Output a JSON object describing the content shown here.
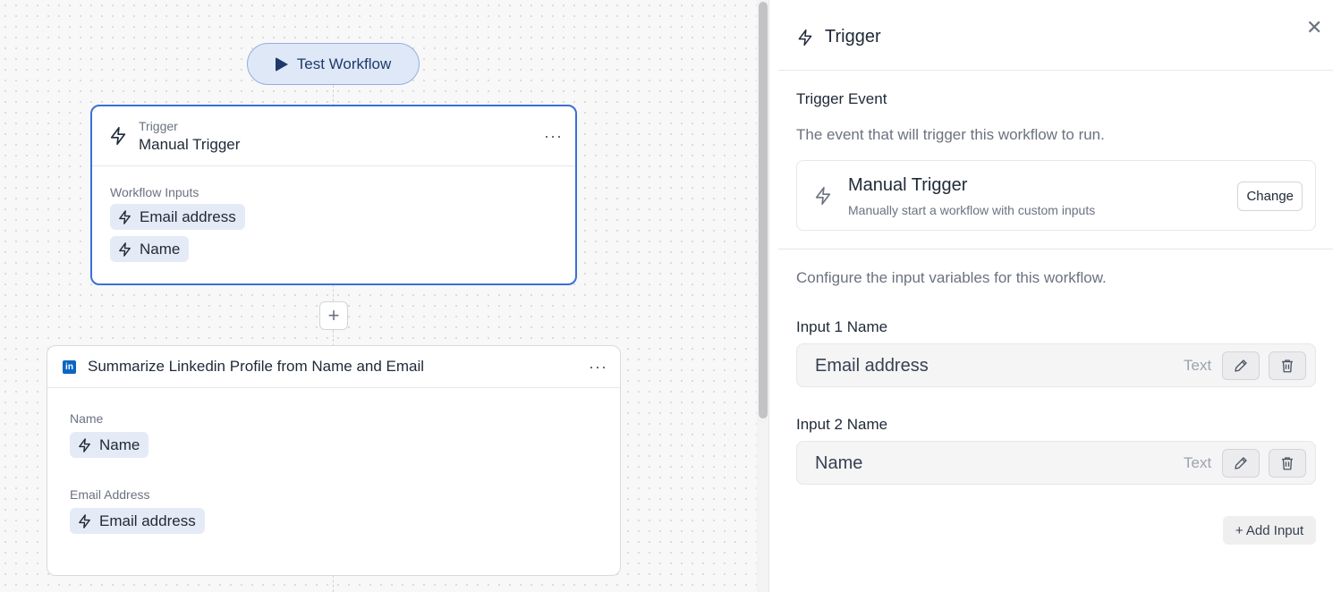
{
  "canvas": {
    "test_button_label": "Test Workflow",
    "trigger_node": {
      "type_label": "Trigger",
      "title": "Manual Trigger",
      "section_label": "Workflow Inputs",
      "inputs": [
        "Email address",
        "Name"
      ]
    },
    "action_node": {
      "title": "Summarize Linkedin Profile from Name and Email",
      "icon_letter": "in",
      "fields": [
        {
          "label": "Name",
          "value": "Name"
        },
        {
          "label": "Email Address",
          "value": "Email address"
        }
      ]
    },
    "add_step_symbol": "+",
    "more_menu_symbol": "···"
  },
  "panel": {
    "title": "Trigger",
    "close_symbol": "✕",
    "trigger_event_heading": "Trigger Event",
    "trigger_event_desc": "The event that will trigger this workflow to run.",
    "trigger_card": {
      "title": "Manual Trigger",
      "subtitle": "Manually start a workflow with custom inputs",
      "change_label": "Change"
    },
    "config_desc": "Configure the input variables for this workflow.",
    "inputs": [
      {
        "label": "Input 1 Name",
        "value": "Email address",
        "type": "Text"
      },
      {
        "label": "Input 2 Name",
        "value": "Name",
        "type": "Text"
      }
    ],
    "add_input_label": "+ Add Input"
  },
  "colors": {
    "accent_blue": "#3b6fd6",
    "chip_bg": "#e4ebf7",
    "linkedin": "#0a66c2"
  }
}
